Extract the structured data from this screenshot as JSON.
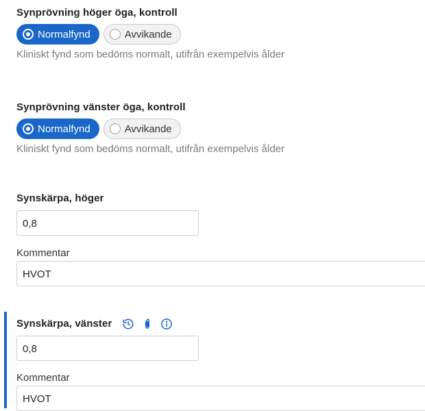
{
  "right_eye": {
    "label": "Synprövning höger öga, kontroll",
    "options": [
      "Normalfynd",
      "Avvikande"
    ],
    "selected": "Normalfynd",
    "help": "Kliniskt fynd som bedöms normalt, utifrån exempelvis ålder"
  },
  "left_eye": {
    "label": "Synprövning vänster öga, kontroll",
    "options": [
      "Normalfynd",
      "Avvikande"
    ],
    "selected": "Normalfynd",
    "help": "Kliniskt fynd som bedöms normalt, utifrån exempelvis ålder"
  },
  "acuity_right": {
    "label": "Synskärpa, höger",
    "value": "0,8",
    "comment_label": "Kommentar",
    "comment_value": "HVOT"
  },
  "acuity_left": {
    "label": "Synskärpa, vänster",
    "value": "0,8",
    "comment_label": "Kommentar",
    "comment_value": "HVOT",
    "icons": [
      "history-icon",
      "paperclip-icon",
      "info-icon"
    ]
  },
  "colors": {
    "accent": "#1a66c9",
    "help_text": "#7a7a7a"
  }
}
